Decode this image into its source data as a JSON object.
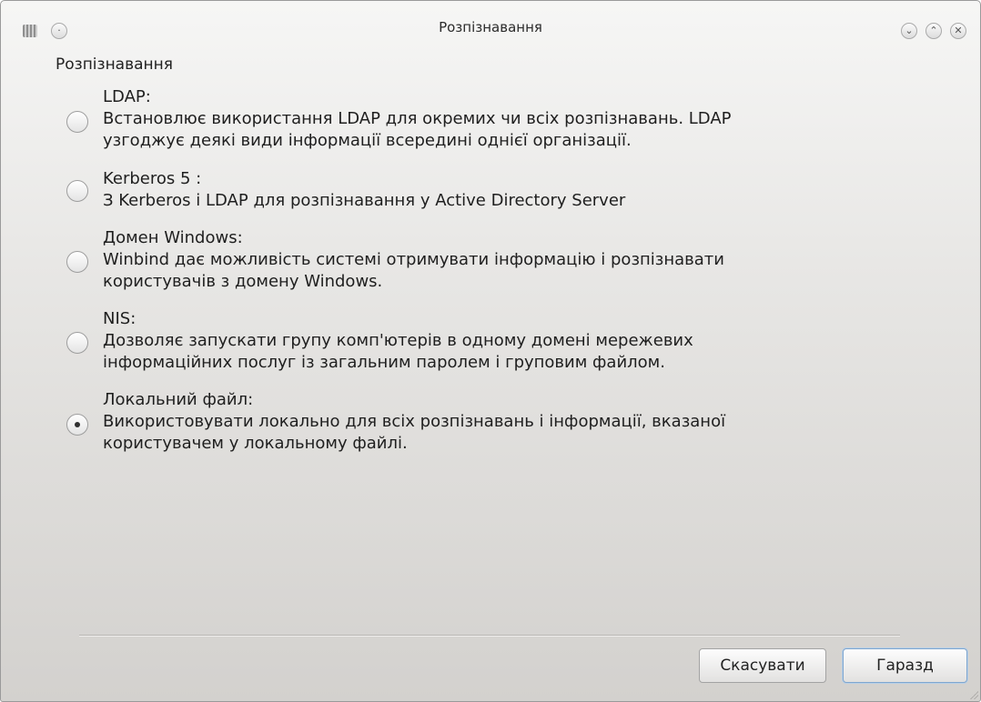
{
  "window": {
    "title": "Розпізнавання",
    "app_icon": "drive-icon",
    "menu_icon": "dot-circle-icon",
    "controls": {
      "minimize_icon": "chevron-down-icon",
      "maximize_icon": "chevron-up-icon",
      "close_icon": "close-icon",
      "minimize_glyph": "⌄",
      "maximize_glyph": "⌃",
      "close_glyph": "✕",
      "menu_glyph": "·"
    }
  },
  "group": {
    "label": "Розпізнавання"
  },
  "options": [
    {
      "title": "LDAP:",
      "line1": "Встановлює використання LDAP для окремих чи всіх розпізнавань. LDAP",
      "line2": "узгоджує деякі види інформації всередині однієї організації.",
      "selected": false
    },
    {
      "title": "Kerberos 5 :",
      "line1": "З Kerberos і LDAP для розпізнавання у Active Directory Server",
      "line2": "",
      "selected": false
    },
    {
      "title": "Домен Windows:",
      "line1": "Winbind дає можливість системі отримувати інформацію і розпізнавати",
      "line2": "користувачів з домену Windows.",
      "selected": false
    },
    {
      "title": "NIS:",
      "line1": "Дозволяє запускати групу комп'ютерів в одному домені мережевих",
      "line2": "інформаційних послуг із загальним паролем і груповим файлом.",
      "selected": false
    },
    {
      "title": "Локальний файл:",
      "line1": "Використовувати локально для всіх розпізнавань і інформації, вказаної",
      "line2": "користувачем у локальному файлі.",
      "selected": true
    }
  ],
  "buttons": {
    "cancel_label": "Скасувати",
    "ok_label": "Гаразд"
  },
  "colors": {
    "background_top": "#f6f6f5",
    "background_bottom": "#d3d1ce",
    "text": "#1f1f1f",
    "default_button_border": "#7fa6cf"
  }
}
